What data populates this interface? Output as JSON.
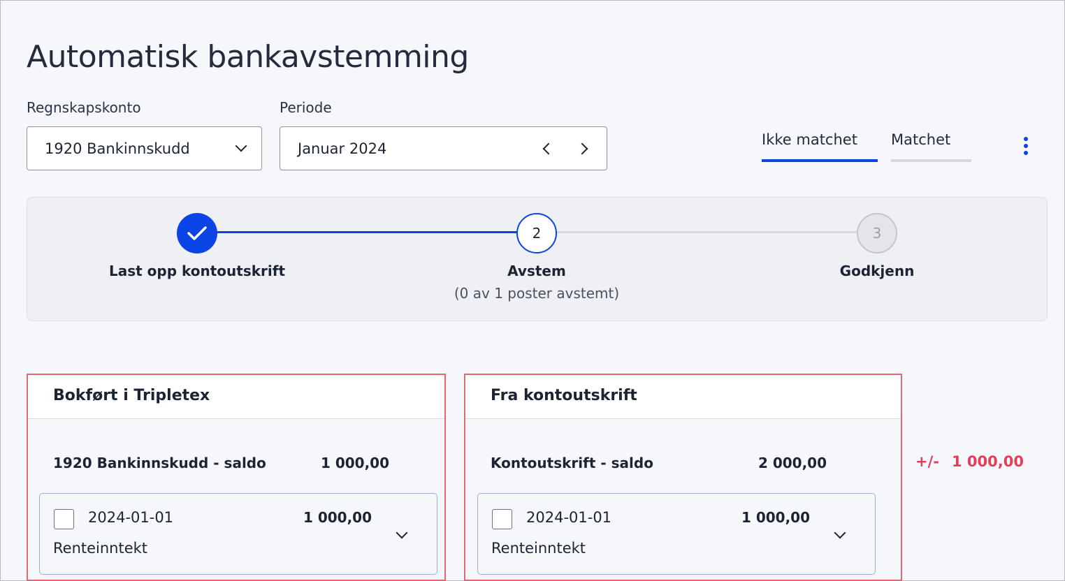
{
  "page": {
    "title": "Automatisk bankavstemming"
  },
  "filters": {
    "account_label": "Regnskapskonto",
    "account_value": "1920 Bankinnskudd",
    "period_label": "Periode",
    "period_value": "Januar 2024"
  },
  "tabs": [
    {
      "label": "Ikke matchet",
      "active": true
    },
    {
      "label": "Matchet",
      "active": false
    }
  ],
  "stepper": {
    "steps": [
      {
        "number": "1",
        "label": "Last opp kontoutskrift",
        "sub": "",
        "state": "done"
      },
      {
        "number": "2",
        "label": "Avstem",
        "sub": "(0 av 1 poster avstemt)",
        "state": "current"
      },
      {
        "number": "3",
        "label": "Godkjenn",
        "sub": "",
        "state": "pending"
      }
    ]
  },
  "panels": {
    "left": {
      "title": "Bokført i Tripletex",
      "saldo_label": "1920 Bankinnskudd - saldo",
      "saldo_value": "1 000,00",
      "entry": {
        "date": "2024-01-01",
        "amount": "1 000,00",
        "description": "Renteinntekt"
      }
    },
    "right": {
      "title": "Fra kontoutskrift",
      "saldo_label": "Kontoutskrift - saldo",
      "saldo_value": "2 000,00",
      "entry": {
        "date": "2024-01-01",
        "amount": "1 000,00",
        "description": "Renteinntekt"
      }
    }
  },
  "difference": {
    "sign": "+/-",
    "value": "1 000,00"
  },
  "colors": {
    "accent": "#0a43e6",
    "danger": "#e33e5a",
    "highlight_border": "#e36770"
  }
}
